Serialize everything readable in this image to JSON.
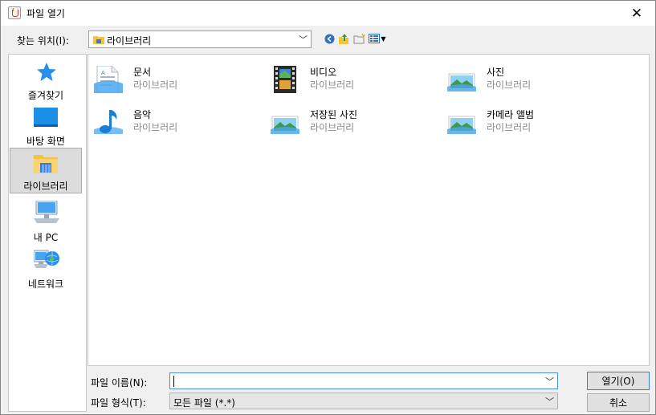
{
  "window": {
    "title": "파일 열기"
  },
  "lookin": {
    "label": "찾는 위치(I):",
    "value": "라이브러리"
  },
  "places": [
    {
      "label": "즐겨찾기",
      "icon": "star-icon"
    },
    {
      "label": "바탕 화면",
      "icon": "desktop-icon"
    },
    {
      "label": "라이브러리",
      "icon": "library-icon",
      "selected": true
    },
    {
      "label": "내 PC",
      "icon": "computer-icon"
    },
    {
      "label": "네트워크",
      "icon": "network-icon"
    }
  ],
  "files": [
    {
      "name": "문서",
      "type": "라이브러리",
      "icon": "document-icon"
    },
    {
      "name": "비디오",
      "type": "라이브러리",
      "icon": "video-icon"
    },
    {
      "name": "사진",
      "type": "라이브러리",
      "icon": "picture-icon"
    },
    {
      "name": "음악",
      "type": "라이브러리",
      "icon": "music-icon"
    },
    {
      "name": "저장된 사진",
      "type": "라이브러리",
      "icon": "picture-icon"
    },
    {
      "name": "카메라 앨범",
      "type": "라이브러리",
      "icon": "picture-icon"
    }
  ],
  "filename": {
    "label": "파일 이름(N):",
    "value": ""
  },
  "filetype": {
    "label": "파일 형식(T):",
    "value": "모든 파일 (*.*)"
  },
  "buttons": {
    "open": "열기(O)",
    "cancel": "취소"
  },
  "colors": {
    "accent": "#3c7fd1",
    "folder_yellow": "#f5c242",
    "star_blue": "#1e90ff"
  }
}
